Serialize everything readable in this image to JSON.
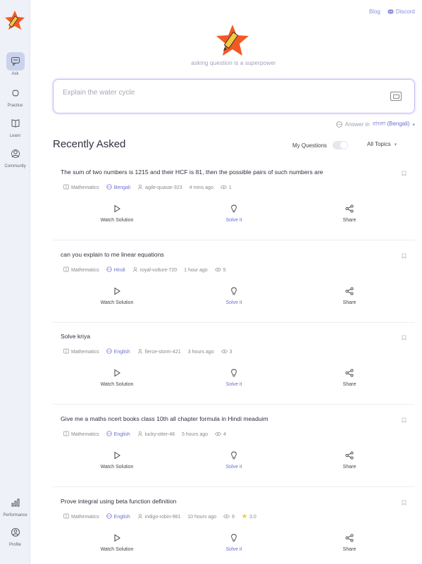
{
  "sidebar": {
    "items": [
      {
        "label": "Ask",
        "icon": "chat-icon",
        "active": true
      },
      {
        "label": "Practice",
        "icon": "brain-icon",
        "active": false
      },
      {
        "label": "Learn",
        "icon": "book-icon",
        "active": false
      },
      {
        "label": "Community",
        "icon": "community-icon",
        "active": false
      }
    ],
    "bottom": [
      {
        "label": "Performance",
        "icon": "bar-chart-icon"
      },
      {
        "label": "Profile",
        "icon": "profile-icon"
      }
    ]
  },
  "top_links": {
    "blog": "Blog",
    "discord": "Discord"
  },
  "tagline": "asking question is a superpower",
  "ask": {
    "placeholder": "Explain the water cycle"
  },
  "answer_in": {
    "label": "Answer in",
    "language": "বাংলা (Bengali)"
  },
  "recently": {
    "title": "Recently Asked",
    "my_questions": "My Questions",
    "topics": "All Topics"
  },
  "actions": {
    "watch": "Watch Solution",
    "solve": "Solve it",
    "share": "Share"
  },
  "questions": [
    {
      "text": "The sum of two numbers is 1215 and their HCF is 81, then the possible pairs of such numbers are",
      "subject": "Mathematics",
      "language": "Bengali",
      "user": "agile-quasar-323",
      "time": "4 mins ago",
      "views": "1",
      "rating": ""
    },
    {
      "text": "can you explain to me linear equations",
      "subject": "Mathematics",
      "language": "Hindi",
      "user": "royal-vulture-720",
      "time": "1 hour ago",
      "views": "5",
      "rating": ""
    },
    {
      "text": "Solve kriya",
      "subject": "Mathematics",
      "language": "English",
      "user": "fierce-storm-421",
      "time": "3 hours ago",
      "views": "3",
      "rating": ""
    },
    {
      "text": "Give me a maths ncert books class 10th all chapter formula in Hindi meaduim",
      "subject": "Mathematics",
      "language": "English",
      "user": "lucky-otter-48",
      "time": "5 hours ago",
      "views": "4",
      "rating": ""
    },
    {
      "text": "Prove integral using beta function definition",
      "subject": "Mathematics",
      "language": "English",
      "user": "indigo-robin-981",
      "time": "10 hours ago",
      "views": "6",
      "rating": "3.0"
    }
  ],
  "colors": {
    "accent": "#6a6fd1",
    "sidebar_bg": "#eef1f8",
    "input_border": "#c7b8f2"
  }
}
